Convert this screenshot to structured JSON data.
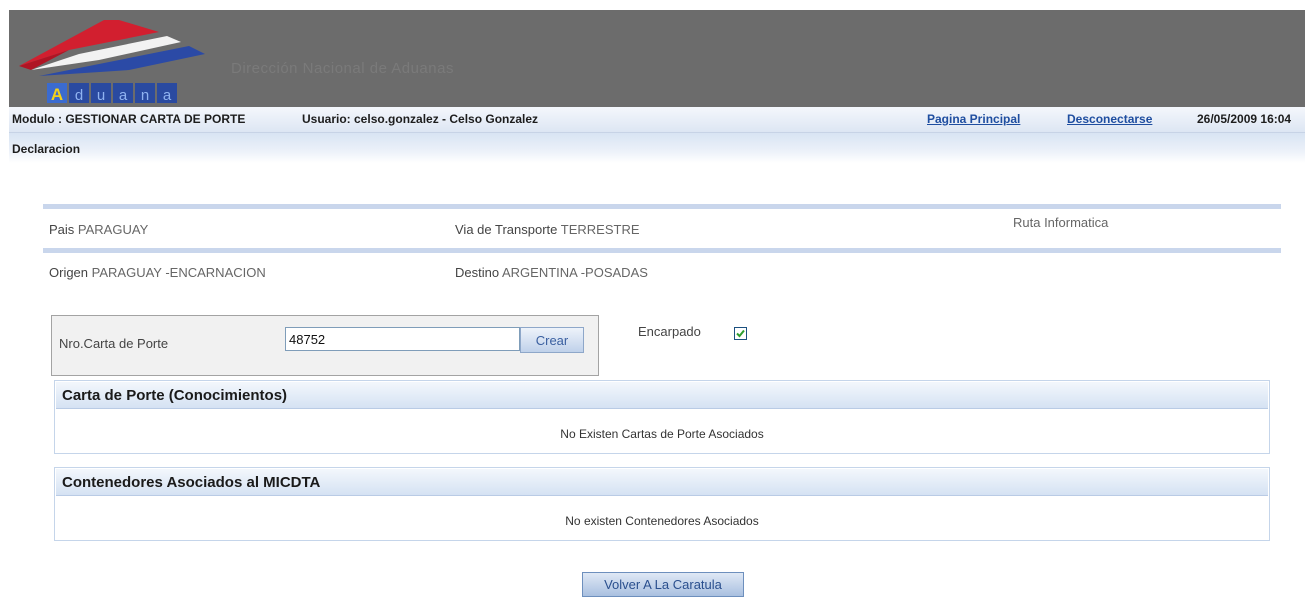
{
  "header": {
    "logo_text": "Aduana",
    "faded_text": "Dirección Nacional de Aduanas"
  },
  "modbar": {
    "modulo": "Modulo : GESTIONAR CARTA DE PORTE",
    "usuario": "Usuario: celso.gonzalez - Celso Gonzalez",
    "pagina_principal": "Pagina Principal",
    "desconectarse": "Desconectarse",
    "datetime": "26/05/2009 16:04"
  },
  "menu": {
    "declaracion": "Declaracion"
  },
  "info": {
    "pais_label": "Pais",
    "pais_value": "PARAGUAY",
    "via_label": "Via de Transporte",
    "via_value": "TERRESTRE",
    "ruta": "Ruta Informatica",
    "origen_label": "Origen",
    "origen_value": "PARAGUAY -ENCARNACION",
    "destino_label": "Destino",
    "destino_value": "ARGENTINA -POSADAS"
  },
  "form": {
    "nro_label": "Nro.Carta de Porte",
    "nro_value": "48752",
    "crear": "Crear",
    "encarpado_label": "Encarpado",
    "encarpado_checked": true
  },
  "sections": {
    "carta": {
      "title": "Carta de Porte (Conocimientos)",
      "message": "No Existen Cartas de Porte Asociados"
    },
    "contenedores": {
      "title": "Contenedores Asociados al MICDTA",
      "message": "No existen Contenedores Asociados"
    }
  },
  "footer": {
    "volver": "Volver A La Caratula"
  },
  "colors": {
    "banner": "#6c6c6c",
    "logo_red": "#c8102e",
    "logo_blue": "#1f3f9a",
    "link": "#1f4ea0"
  }
}
